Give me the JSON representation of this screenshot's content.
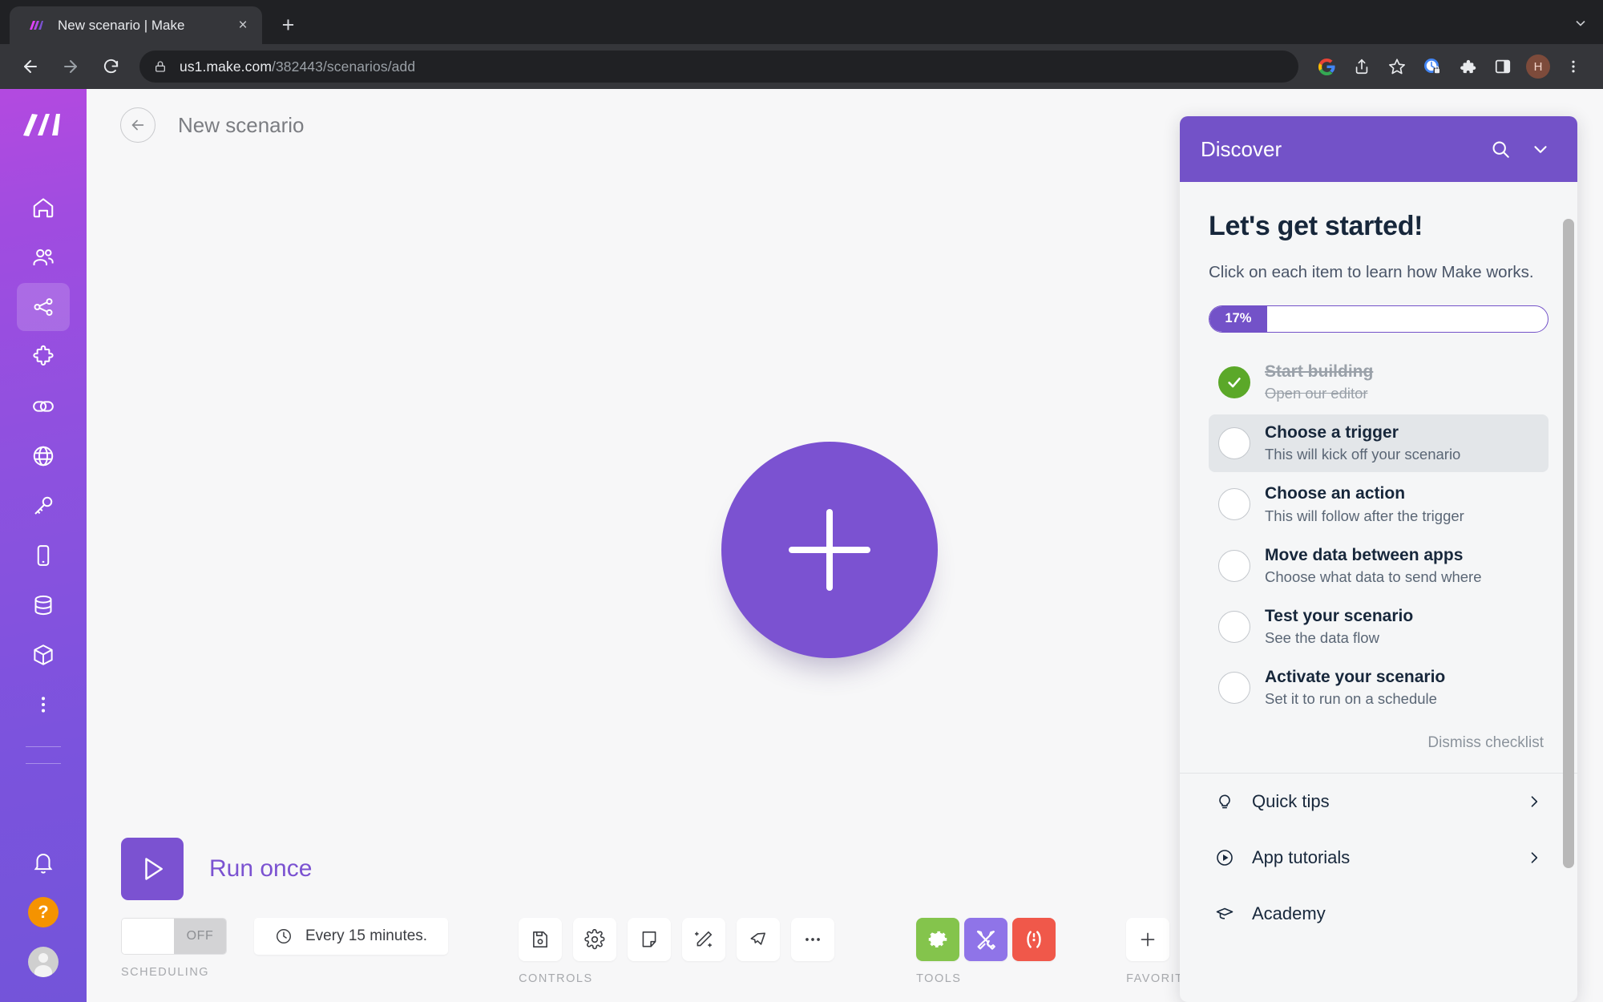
{
  "browser": {
    "tab": {
      "title": "New scenario | Make",
      "favicon": "make-logo-icon",
      "close": "×"
    },
    "new_tab_label": "+",
    "tabstrip_chevron": "chevron-down-icon",
    "url": {
      "host": "us1.make.com",
      "path": "/382443/scenarios/add"
    },
    "nav": {
      "back": "back-icon",
      "forward": "forward-icon",
      "reload": "reload-icon"
    },
    "toolbar_icons": [
      "google-icon",
      "share-icon",
      "bookmark-star-icon",
      "password-manager-icon",
      "extensions-puzzle-icon",
      "side-panel-icon",
      "profile-avatar",
      "chrome-menu-icon"
    ],
    "profile_initial": "H"
  },
  "sidebar": {
    "logo": "make-logo-icon",
    "items": [
      {
        "name": "home",
        "icon": "home-icon",
        "active": false
      },
      {
        "name": "organization",
        "icon": "people-icon",
        "active": false
      },
      {
        "name": "scenarios",
        "icon": "share-nodes-icon",
        "active": true
      },
      {
        "name": "templates",
        "icon": "puzzle-icon",
        "active": false
      },
      {
        "name": "connections",
        "icon": "link-icon",
        "active": false
      },
      {
        "name": "webhooks",
        "icon": "globe-icon",
        "active": false
      },
      {
        "name": "keys",
        "icon": "key-icon",
        "active": false
      },
      {
        "name": "devices",
        "icon": "phone-icon",
        "active": false
      },
      {
        "name": "data-stores",
        "icon": "database-icon",
        "active": false
      },
      {
        "name": "data-structures",
        "icon": "cube-icon",
        "active": false
      },
      {
        "name": "more",
        "icon": "more-vertical-icon",
        "active": false
      }
    ],
    "bottom": [
      {
        "name": "notifications",
        "icon": "bell-icon"
      },
      {
        "name": "help",
        "icon": "question-mark-icon",
        "color": "#f59300"
      },
      {
        "name": "user-profile",
        "icon": "avatar-icon"
      }
    ]
  },
  "scenario": {
    "back_icon": "arrow-left-circle-icon",
    "title": "New scenario",
    "add_module_icon": "plus-icon"
  },
  "bottombar": {
    "run_once_label": "Run once",
    "run_icon": "play-icon",
    "scheduling": {
      "group_label": "SCHEDULING",
      "toggle_state": "OFF",
      "schedule_text": "Every 15 minutes.",
      "clock_icon": "clock-icon"
    },
    "controls": {
      "group_label": "CONTROLS",
      "items": [
        {
          "name": "save",
          "icon": "save-floppy-icon"
        },
        {
          "name": "settings",
          "icon": "gear-icon"
        },
        {
          "name": "notes",
          "icon": "note-icon"
        },
        {
          "name": "auto-align",
          "icon": "magic-wand-icon"
        },
        {
          "name": "explore",
          "icon": "paper-plane-icon"
        },
        {
          "name": "more",
          "icon": "ellipsis-icon"
        }
      ]
    },
    "tools": {
      "group_label": "TOOLS",
      "items": [
        {
          "name": "tools-green",
          "icon": "gear-icon",
          "color": "#84c44c"
        },
        {
          "name": "tools-purple",
          "icon": "tools-crossed-icon",
          "color": "#8f74e8"
        },
        {
          "name": "tools-red",
          "icon": "regex-brackets-icon",
          "color": "#f0584a"
        }
      ]
    },
    "favorites": {
      "group_label": "FAVORITES",
      "add_icon": "plus-icon"
    }
  },
  "discover": {
    "title": "Discover",
    "search_icon": "search-icon",
    "collapse_icon": "chevron-down-icon",
    "heading": "Let's get started!",
    "description": "Click on each item to learn how Make works.",
    "progress": {
      "percent_label": "17%",
      "value": 17
    },
    "checklist": [
      {
        "title": "Start building",
        "subtitle": "Open our editor",
        "done": true,
        "highlight": false
      },
      {
        "title": "Choose a trigger",
        "subtitle": "This will kick off your scenario",
        "done": false,
        "highlight": true
      },
      {
        "title": "Choose an action",
        "subtitle": "This will follow after the trigger",
        "done": false,
        "highlight": false
      },
      {
        "title": "Move data between apps",
        "subtitle": "Choose what data to send where",
        "done": false,
        "highlight": false
      },
      {
        "title": "Test your scenario",
        "subtitle": "See the data flow",
        "done": false,
        "highlight": false
      },
      {
        "title": "Activate your scenario",
        "subtitle": "Set it to run on a schedule",
        "done": false,
        "highlight": false
      }
    ],
    "dismiss_label": "Dismiss checklist",
    "links": [
      {
        "label": "Quick tips",
        "icon": "lightbulb-icon",
        "chevron": true
      },
      {
        "label": "App tutorials",
        "icon": "play-circle-icon",
        "chevron": true
      },
      {
        "label": "Academy",
        "icon": "graduation-cap-icon",
        "chevron": false
      }
    ]
  },
  "colors": {
    "brand_purple": "#7b52d1",
    "discover_header": "#7352c8",
    "done_green": "#5ba829",
    "help_orange": "#f59300"
  }
}
